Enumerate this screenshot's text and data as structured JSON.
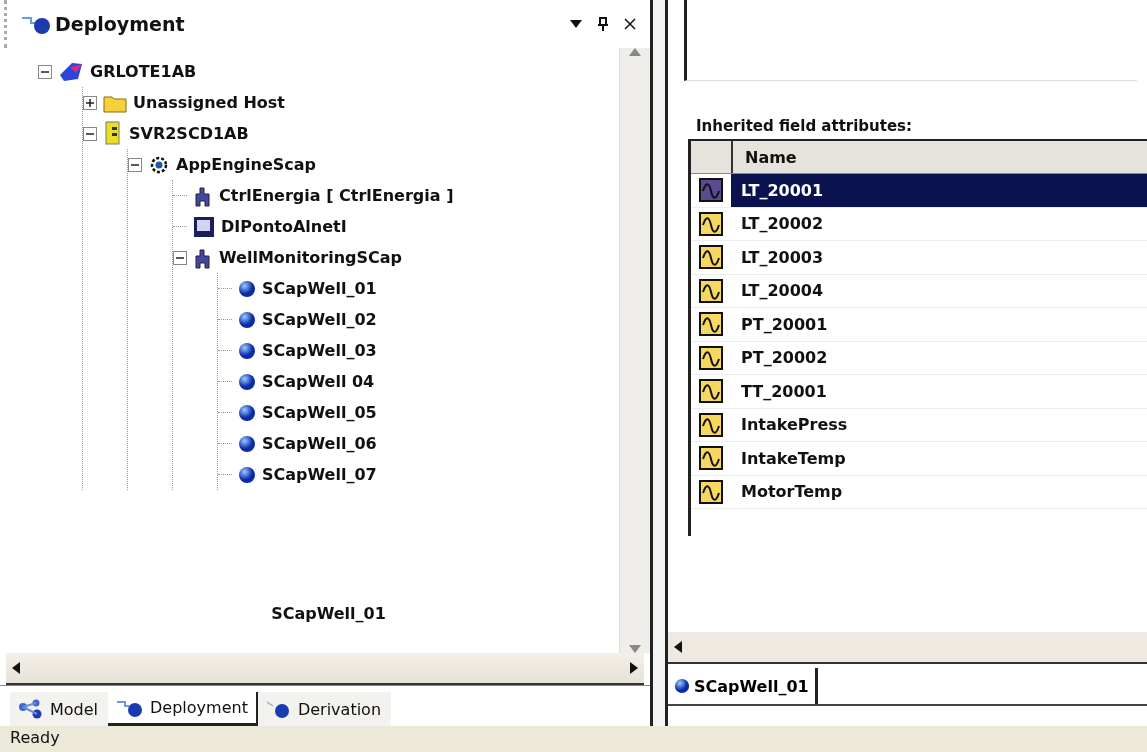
{
  "panel": {
    "title": "Deployment"
  },
  "tree": [
    {
      "label": "GRLOTE1AB",
      "kind": "galaxy",
      "expanded": true,
      "children": [
        {
          "label": "Unassigned Host",
          "kind": "folder",
          "expanded": false
        },
        {
          "label": "SVR2SCD1AB",
          "kind": "server",
          "expanded": true,
          "children": [
            {
              "label": "AppEngineScap",
              "kind": "engine",
              "expanded": true,
              "children": [
                {
                  "label": "CtrlEnergia [ CtrlEnergia ]",
                  "kind": "object"
                },
                {
                  "label": "DIPontoAlnetI",
                  "kind": "device"
                },
                {
                  "label": "WellMonitoringSCap",
                  "kind": "object",
                  "expanded": true,
                  "children": [
                    {
                      "label": "SCapWell_01",
                      "kind": "instance"
                    },
                    {
                      "label": "SCapWell_02",
                      "kind": "instance"
                    },
                    {
                      "label": "SCapWell_03",
                      "kind": "instance"
                    },
                    {
                      "label": "SCapWell 04",
                      "kind": "instance"
                    },
                    {
                      "label": "SCapWell_05",
                      "kind": "instance"
                    },
                    {
                      "label": "SCapWell_06",
                      "kind": "instance"
                    },
                    {
                      "label": "SCapWell_07",
                      "kind": "instance"
                    }
                  ]
                }
              ]
            }
          ]
        }
      ]
    }
  ],
  "drag_caption": "SCapWell_01",
  "bottom_tabs": [
    {
      "label": "Model",
      "kind": "model",
      "selected": false
    },
    {
      "label": "Deployment",
      "kind": "deployment",
      "selected": true
    },
    {
      "label": "Derivation",
      "kind": "derivation",
      "selected": false
    }
  ],
  "status_bar": "Ready",
  "attributes": {
    "label": "Inherited field attributes:",
    "columns": [
      "Name"
    ],
    "rows": [
      {
        "name": "LT_20001",
        "selected": true
      },
      {
        "name": "LT_20002",
        "selected": false
      },
      {
        "name": "LT_20003",
        "selected": false
      },
      {
        "name": "LT_20004",
        "selected": false
      },
      {
        "name": "PT_20001",
        "selected": false
      },
      {
        "name": "PT_20002",
        "selected": false
      },
      {
        "name": "TT_20001",
        "selected": false
      },
      {
        "name": "IntakePress",
        "selected": false
      },
      {
        "name": "IntakeTemp",
        "selected": false
      },
      {
        "name": "MotorTemp",
        "selected": false
      }
    ]
  },
  "editor_tabs": [
    {
      "label": "SCapWell_01",
      "selected": true
    }
  ]
}
